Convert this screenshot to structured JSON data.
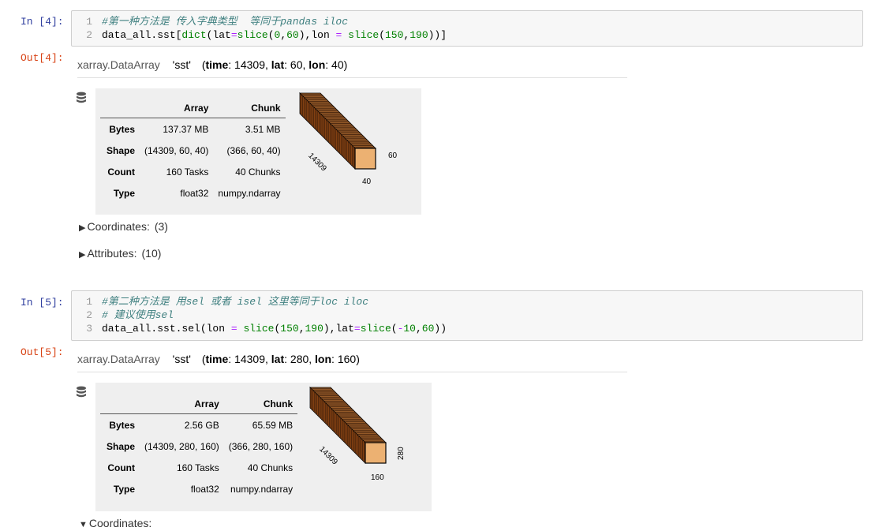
{
  "cells": [
    {
      "in_prompt": "In [4]:",
      "out_prompt": "Out[4]:",
      "code": [
        {
          "n": "1",
          "tokens": [
            {
              "c": "cm",
              "t": "#第一种方法是 传入字典类型  等同于pandas iloc"
            }
          ]
        },
        {
          "n": "2",
          "tokens": [
            {
              "c": "name",
              "t": "data_all.sst["
            },
            {
              "c": "fn",
              "t": "dict"
            },
            {
              "c": "name",
              "t": "(lat"
            },
            {
              "c": "op",
              "t": "="
            },
            {
              "c": "fn",
              "t": "slice"
            },
            {
              "c": "name",
              "t": "("
            },
            {
              "c": "num",
              "t": "0"
            },
            {
              "c": "name",
              "t": ","
            },
            {
              "c": "num",
              "t": "60"
            },
            {
              "c": "name",
              "t": "),lon "
            },
            {
              "c": "op",
              "t": "="
            },
            {
              "c": "name",
              "t": " "
            },
            {
              "c": "fn",
              "t": "slice"
            },
            {
              "c": "name",
              "t": "("
            },
            {
              "c": "num",
              "t": "150"
            },
            {
              "c": "name",
              "t": ","
            },
            {
              "c": "num",
              "t": "190"
            },
            {
              "c": "name",
              "t": "))]"
            }
          ]
        }
      ],
      "output": {
        "type_label": "xarray.DataArray",
        "var_name": "'sst'",
        "dims_open": "(",
        "dims": [
          {
            "k": "time",
            "v": ": 14309, "
          },
          {
            "k": "lat",
            "v": ": 60, "
          },
          {
            "k": "lon",
            "v": ": 40"
          }
        ],
        "dims_close": ")",
        "table": {
          "headers": [
            "",
            "Array",
            "Chunk"
          ],
          "rows": [
            {
              "label": "Bytes",
              "array": "137.37 MB",
              "chunk": "3.51 MB"
            },
            {
              "label": "Shape",
              "array": "(14309, 60, 40)",
              "chunk": "(366, 60, 40)"
            },
            {
              "label": "Count",
              "array": "160 Tasks",
              "chunk": "40 Chunks"
            },
            {
              "label": "Type",
              "array": "float32",
              "chunk": "numpy.ndarray"
            }
          ]
        },
        "cube_labels": {
          "depth": "14309",
          "right": "60",
          "bottom": "40"
        },
        "sections": [
          {
            "arrow": "▶",
            "label": "Coordinates:",
            "count": "(3)"
          },
          {
            "arrow": "▶",
            "label": "Attributes:",
            "count": "(10)"
          }
        ]
      }
    },
    {
      "in_prompt": "In [5]:",
      "out_prompt": "Out[5]:",
      "code": [
        {
          "n": "1",
          "tokens": [
            {
              "c": "cm",
              "t": "#第二种方法是 用sel 或者 isel 这里等同于loc iloc"
            }
          ]
        },
        {
          "n": "2",
          "tokens": [
            {
              "c": "cm",
              "t": "# 建议使用sel"
            }
          ]
        },
        {
          "n": "3",
          "tokens": [
            {
              "c": "name",
              "t": "data_all.sst.sel(lon "
            },
            {
              "c": "op",
              "t": "="
            },
            {
              "c": "name",
              "t": " "
            },
            {
              "c": "fn",
              "t": "slice"
            },
            {
              "c": "name",
              "t": "("
            },
            {
              "c": "num",
              "t": "150"
            },
            {
              "c": "name",
              "t": ","
            },
            {
              "c": "num",
              "t": "190"
            },
            {
              "c": "name",
              "t": "),lat"
            },
            {
              "c": "op",
              "t": "="
            },
            {
              "c": "fn",
              "t": "slice"
            },
            {
              "c": "name",
              "t": "("
            },
            {
              "c": "op",
              "t": "-"
            },
            {
              "c": "num",
              "t": "10"
            },
            {
              "c": "name",
              "t": ","
            },
            {
              "c": "num",
              "t": "60"
            },
            {
              "c": "name",
              "t": "))"
            }
          ]
        }
      ],
      "output": {
        "type_label": "xarray.DataArray",
        "var_name": "'sst'",
        "dims_open": "(",
        "dims": [
          {
            "k": "time",
            "v": ": 14309, "
          },
          {
            "k": "lat",
            "v": ": 280, "
          },
          {
            "k": "lon",
            "v": ": 160"
          }
        ],
        "dims_close": ")",
        "table": {
          "headers": [
            "",
            "Array",
            "Chunk"
          ],
          "rows": [
            {
              "label": "Bytes",
              "array": "2.56 GB",
              "chunk": "65.59 MB"
            },
            {
              "label": "Shape",
              "array": "(14309, 280, 160)",
              "chunk": "(366, 280, 160)"
            },
            {
              "label": "Count",
              "array": "160 Tasks",
              "chunk": "40 Chunks"
            },
            {
              "label": "Type",
              "array": "float32",
              "chunk": "numpy.ndarray"
            }
          ]
        },
        "cube_labels": {
          "depth": "14309",
          "right": "280",
          "bottom": "160"
        },
        "sections": [
          {
            "arrow": "▼",
            "label": "Coordinates:",
            "count": ""
          }
        ]
      }
    }
  ],
  "colors": {
    "in_prompt": "#303f9f",
    "out_prompt": "#d84315",
    "comment": "#408080",
    "builtin": "#008000",
    "operator": "#aa22ff",
    "cube_face": "#ECB172",
    "cube_dark": "#8B4513"
  }
}
